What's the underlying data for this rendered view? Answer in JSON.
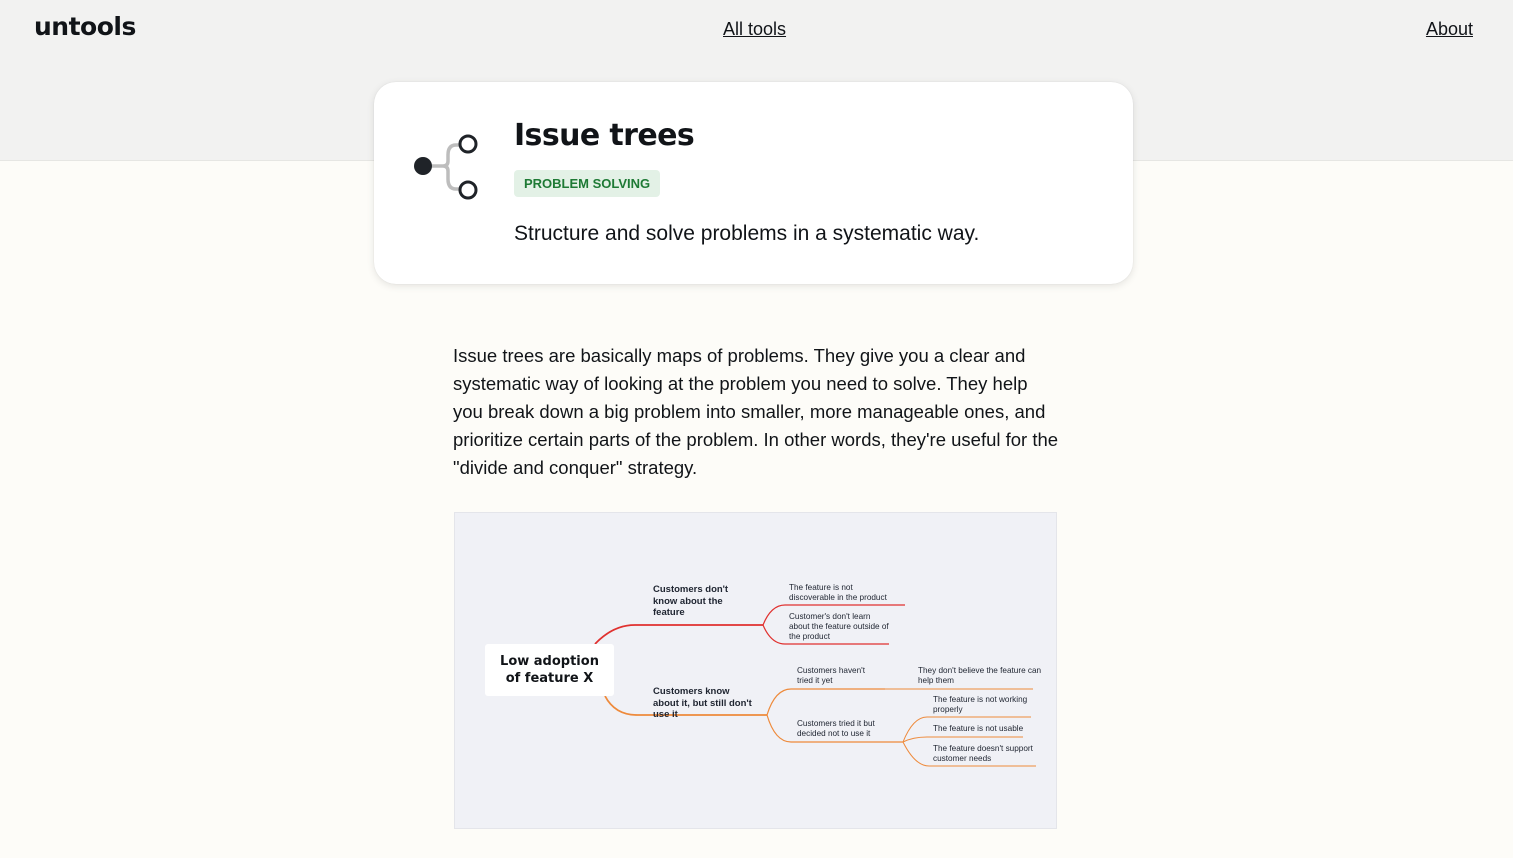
{
  "header": {
    "logo": "untools",
    "nav_all_tools": "All tools",
    "nav_about": "About"
  },
  "hero": {
    "icon": "issue-tree-icon",
    "title": "Issue trees",
    "category": "PROBLEM SOLVING",
    "subtitle": "Structure and solve problems in a systematic way."
  },
  "intro": "Issue trees are basically maps of problems. They give you a clear and systematic way of looking at the problem you need to solve. They help you break down a big problem into smaller, more manageable ones, and prioritize certain parts of the problem. In other words, they're useful for the \"divide and conquer\" strategy.",
  "diagram": {
    "root": "Low adoption of feature X",
    "branch_a": {
      "label": "Customers don't know about the feature",
      "children": [
        "The feature is not discoverable in the product",
        "Customer's don't learn about the feature outside of the product"
      ]
    },
    "branch_b": {
      "label": "Customers know about it, but still don't use it",
      "children": [
        {
          "label": "Customers haven't tried it yet",
          "children": [
            "They don't believe the feature can help them"
          ]
        },
        {
          "label": "Customers tried it but decided not to use it",
          "children": [
            "The feature is not working properly",
            "The feature is not usable",
            "The feature doesn't support customer needs"
          ]
        }
      ]
    }
  },
  "colors": {
    "badge_bg": "#e3f1e6",
    "badge_text": "#1e7a35",
    "branch_red": "#e0312f",
    "branch_orange": "#ee8a3b"
  }
}
